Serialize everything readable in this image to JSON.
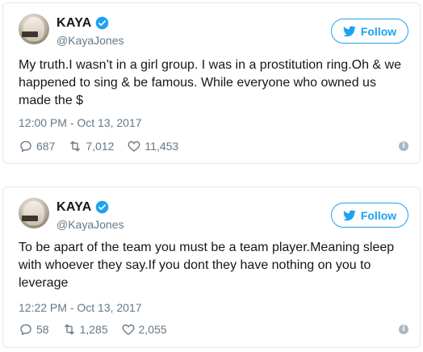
{
  "tweets": [
    {
      "name": "KAYA",
      "handle": "@KayaJones",
      "follow_label": "Follow",
      "text": "My truth.I wasn’t in a girl group. I was in a prostitution ring.Oh & we happened to sing & be famous. While everyone who owned us made the $",
      "timestamp": "12:00 PM - Oct 13, 2017",
      "replies": "687",
      "retweets": "7,012",
      "likes": "11,453"
    },
    {
      "name": "KAYA",
      "handle": "@KayaJones",
      "follow_label": "Follow",
      "text": "To be apart of the team you must be a team player.Meaning sleep with whoever they say.If you dont they have nothing on you to leverage",
      "timestamp": "12:22 PM - Oct 13, 2017",
      "replies": "58",
      "retweets": "1,285",
      "likes": "2,055"
    }
  ],
  "icons": {
    "verified": "verified-badge-icon",
    "bird": "twitter-bird-icon",
    "reply": "reply-icon",
    "retweet": "retweet-icon",
    "like": "heart-icon",
    "info": "info-icon"
  },
  "colors": {
    "accent": "#1da1f2",
    "text": "#14171a",
    "muted": "#657786",
    "border": "#e1e8ed"
  }
}
